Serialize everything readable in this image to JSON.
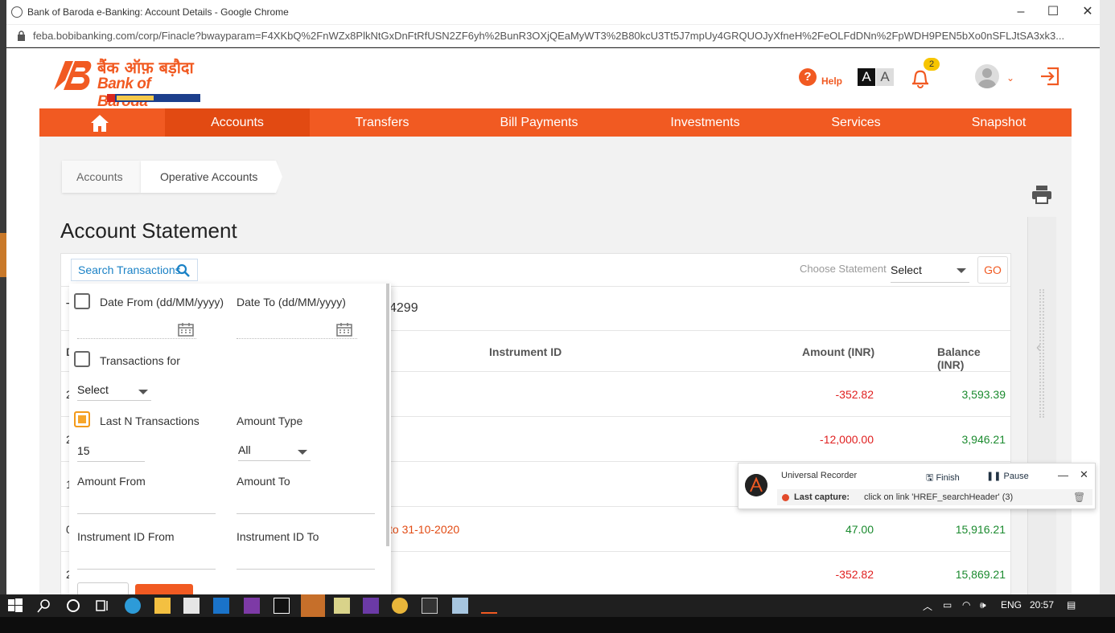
{
  "window": {
    "title": "Bank of Baroda e-Banking: Account Details - Google Chrome",
    "url": "feba.bobibanking.com/corp/Finacle?bwayparam=F4XKbQ%2FnWZx8PlkNtGxDnFtRfUSN2ZF6yh%2BunR3OXjQEaMyWT3%2B80kcU3Tt5J7mpUy4GRQUOJyXfneH%2FeOLFdDNn%2FpWDH9PEN5bXo0nSFLJtSA3xk3..."
  },
  "header": {
    "logo_hindi": "बैंक ऑफ़ बड़ौदा",
    "logo_english": "Bank of Baroda",
    "help_label": "Help",
    "font_large": "A",
    "font_small": "A",
    "notification_count": "2"
  },
  "nav": {
    "items": [
      "Accounts",
      "Transfers",
      "Bill Payments",
      "Investments",
      "Services",
      "Snapshot"
    ],
    "active": "Accounts"
  },
  "breadcrumb": {
    "first": "Accounts",
    "second": "Operative Accounts"
  },
  "page_title": "Account Statement",
  "statement_bar": {
    "search_label": "Search Transactions",
    "choose_label": "Choose Statement",
    "choose_value": "Select",
    "go_label": "GO"
  },
  "account_line": {
    "left": "T",
    "right": "4299"
  },
  "table": {
    "col_first": "D",
    "headers": {
      "instrument": "Instrument ID",
      "amount": "Amount (INR)",
      "balance": "Balance (INR)"
    },
    "rows": [
      {
        "date": "2",
        "desc": "",
        "amount": "-352.82",
        "balance": "3,593.39"
      },
      {
        "date": "2",
        "desc": "",
        "amount": "-12,000.00",
        "balance": "3,946.21"
      },
      {
        "date": "1",
        "desc": "",
        "amount": "",
        "balance": ""
      },
      {
        "date": "0",
        "desc": "to 31-10-2020",
        "amount": "47.00",
        "balance": "15,916.21"
      },
      {
        "date": "2",
        "desc": "",
        "amount": "-352.82",
        "balance": "15,869.21"
      }
    ]
  },
  "search_form": {
    "date_from_label": "Date From (dd/MM/yyyy)",
    "date_to_label": "Date To (dd/MM/yyyy)",
    "transactions_for_label": "Transactions for",
    "transactions_for_value": "Select",
    "last_n_label": "Last N Transactions",
    "last_n_value": "15",
    "amount_type_label": "Amount Type",
    "amount_type_value": "All",
    "amount_from_label": "Amount From",
    "amount_to_label": "Amount To",
    "instrument_from_label": "Instrument ID From",
    "instrument_to_label": "Instrument ID To"
  },
  "recorder": {
    "name": "Universal Recorder",
    "finish_label": "Finish",
    "pause_label": "Pause",
    "last_capture_label": "Last capture:",
    "last_capture_value": "click on link 'HREF_searchHeader' (3)"
  },
  "taskbar": {
    "language": "ENG",
    "time": "20:57"
  },
  "colors": {
    "brand_orange": "#f15a22",
    "negative": "#e02020",
    "positive": "#1a8a2e",
    "link_blue": "#1b82c6"
  }
}
